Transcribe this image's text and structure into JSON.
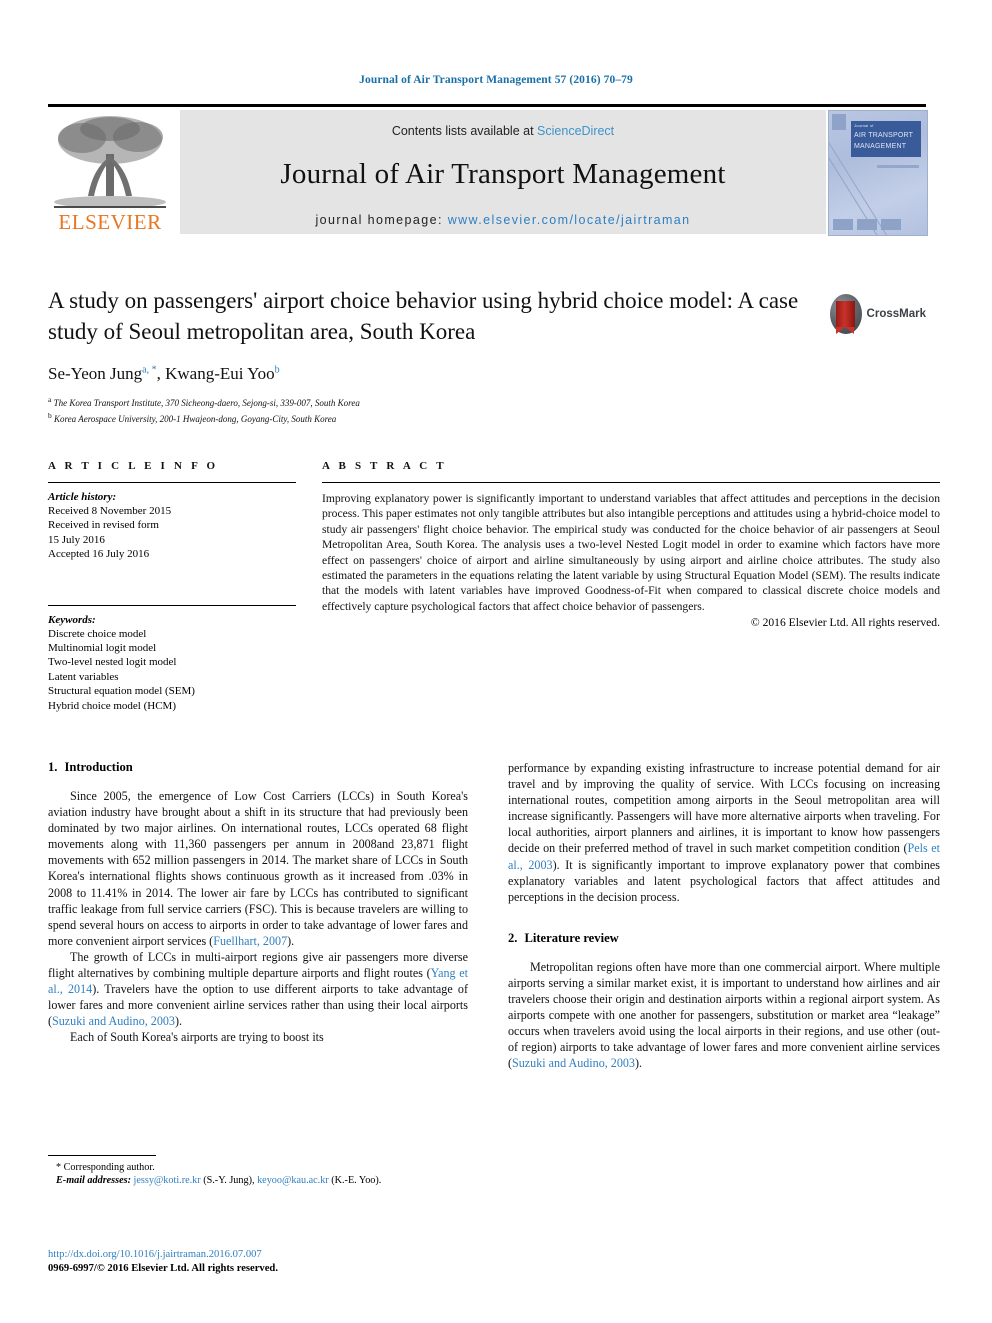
{
  "running_head": "Journal of Air Transport Management 57 (2016) 70–79",
  "masthead": {
    "publisher_logo_text": "ELSEVIER",
    "contents_prefix": "Contents lists available at",
    "contents_link": "ScienceDirect",
    "journal_title": "Journal of Air Transport Management",
    "homepage_prefix": "journal homepage:",
    "homepage_url": "www.elsevier.com/locate/jairtraman",
    "cover_line1": "Journal of",
    "cover_line2": "AIR TRANSPORT",
    "cover_line3": "MANAGEMENT"
  },
  "article": {
    "title": "A study on passengers' airport choice behavior using hybrid choice model: A case study of Seoul metropolitan area, South Korea",
    "authors_part1": "Se-Yeon Jung",
    "author1_sup": "a, *",
    "authors_part2": ", Kwang-Eui Yoo",
    "author2_sup": "b",
    "affiliation_a_sup": "a",
    "affiliation_a": "The Korea Transport Institute, 370 Sicheong-daero, Sejong-si, 339-007, South Korea",
    "affiliation_b_sup": "b",
    "affiliation_b": "Korea Aerospace University, 200-1 Hwajeon-dong, Goyang-City, South Korea",
    "crossmark_label": "CrossMark"
  },
  "article_info": {
    "heading": "A R T I C L E  I N F O",
    "history_label": "Article history:",
    "history": [
      "Received 8 November 2015",
      "Received in revised form",
      "15 July 2016",
      "Accepted 16 July 2016"
    ],
    "keywords_label": "Keywords:",
    "keywords": [
      "Discrete choice model",
      "Multinomial logit model",
      "Two-level nested logit model",
      "Latent variables",
      "Structural equation model (SEM)",
      "Hybrid choice model (HCM)"
    ]
  },
  "abstract": {
    "heading": "A B S T R A C T",
    "text": "Improving explanatory power is significantly important to understand variables that affect attitudes and perceptions in the decision process. This paper estimates not only tangible attributes but also intangible perceptions and attitudes using a hybrid-choice model to study air passengers' flight choice behavior. The empirical study was conducted for the choice behavior of air passengers at Seoul Metropolitan Area, South Korea. The analysis uses a two-level Nested Logit model in order to examine which factors have more effect on passengers' choice of airport and airline simultaneously by using airport and airline choice attributes. The study also estimated the parameters in the equations relating the latent variable by using Structural Equation Model (SEM). The results indicate that the models with latent variables have improved Goodness-of-Fit when compared to classical discrete choice models and effectively capture psychological factors that affect choice behavior of passengers.",
    "copyright": "© 2016 Elsevier Ltd. All rights reserved."
  },
  "body": {
    "section1_num": "1.",
    "section1_title": "Introduction",
    "section2_num": "2.",
    "section2_title": "Literature review",
    "p1_a": "Since 2005, the emergence of Low Cost Carriers (LCCs) in South Korea's aviation industry have brought about a shift in its structure that had previously been dominated by two major airlines. On international routes, LCCs operated 68 flight movements along with 11,360 passengers per annum in 2008and 23,871 flight movements with 652 million passengers in 2014. The market share of LCCs in South Korea's international flights shows continuous growth as it increased from .03% in 2008 to 11.41% in 2014. The lower air fare by LCCs has contributed to significant traffic leakage from full service carriers (FSC). This is because travelers are willing to spend several hours on access to airports in order to take advantage of lower fares and more convenient airport services (",
    "p1_ref": "Fuellhart, 2007",
    "p1_b": ").",
    "p2_a": "The growth of LCCs in multi-airport regions give air passengers more diverse flight alternatives by combining multiple departure airports and flight routes (",
    "p2_ref1": "Yang et al., 2014",
    "p2_b": "). Travelers have the option to use different airports to take advantage of lower fares and more convenient airline services rather than using their local airports (",
    "p2_ref2": "Suzuki and Audino, 2003",
    "p2_c": ").",
    "p3": "Each of South Korea's airports are trying to boost its",
    "p4_a": "performance by expanding existing infrastructure to increase potential demand for air travel and by improving the quality of service. With LCCs focusing on increasing international routes, competition among airports in the Seoul metropolitan area will increase significantly. Passengers will have more alternative airports when traveling. For local authorities, airport planners and airlines, it is important to know how passengers decide on their preferred method of travel in such market competition condition (",
    "p4_ref": "Pels et al., 2003",
    "p4_b": "). It is significantly important to improve explanatory power that combines explanatory variables and latent psychological factors that affect attitudes and perceptions in the decision process.",
    "p5_a": "Metropolitan regions often have more than one commercial airport. Where multiple airports serving a similar market exist, it is important to understand how airlines and air travelers choose their origin and destination airports within a regional airport system. As airports compete with one another for passengers, substitution or market area “leakage” occurs when travelers avoid using the local airports in their regions, and use other (out-of region) airports to take advantage of lower fares and more convenient airline services (",
    "p5_ref": "Suzuki and Audino, 2003",
    "p5_b": ")."
  },
  "footnote": {
    "corresponding": "* Corresponding author.",
    "email_label": "E-mail addresses:",
    "email1": "jessy@koti.re.kr",
    "email1_owner": "(S.-Y. Jung),",
    "email2": "keyoo@kau.ac.kr",
    "email2_owner": "(K.-E. Yoo)."
  },
  "footer": {
    "doi": "http://dx.doi.org/10.1016/j.jairtraman.2016.07.007",
    "issn": "0969-6997/© 2016 Elsevier Ltd. All rights reserved."
  },
  "colors": {
    "link": "#2f7fc0",
    "running_head": "#1a6fa8",
    "elsevier_orange": "#e87722",
    "band_gray": "#e4e4e4"
  }
}
